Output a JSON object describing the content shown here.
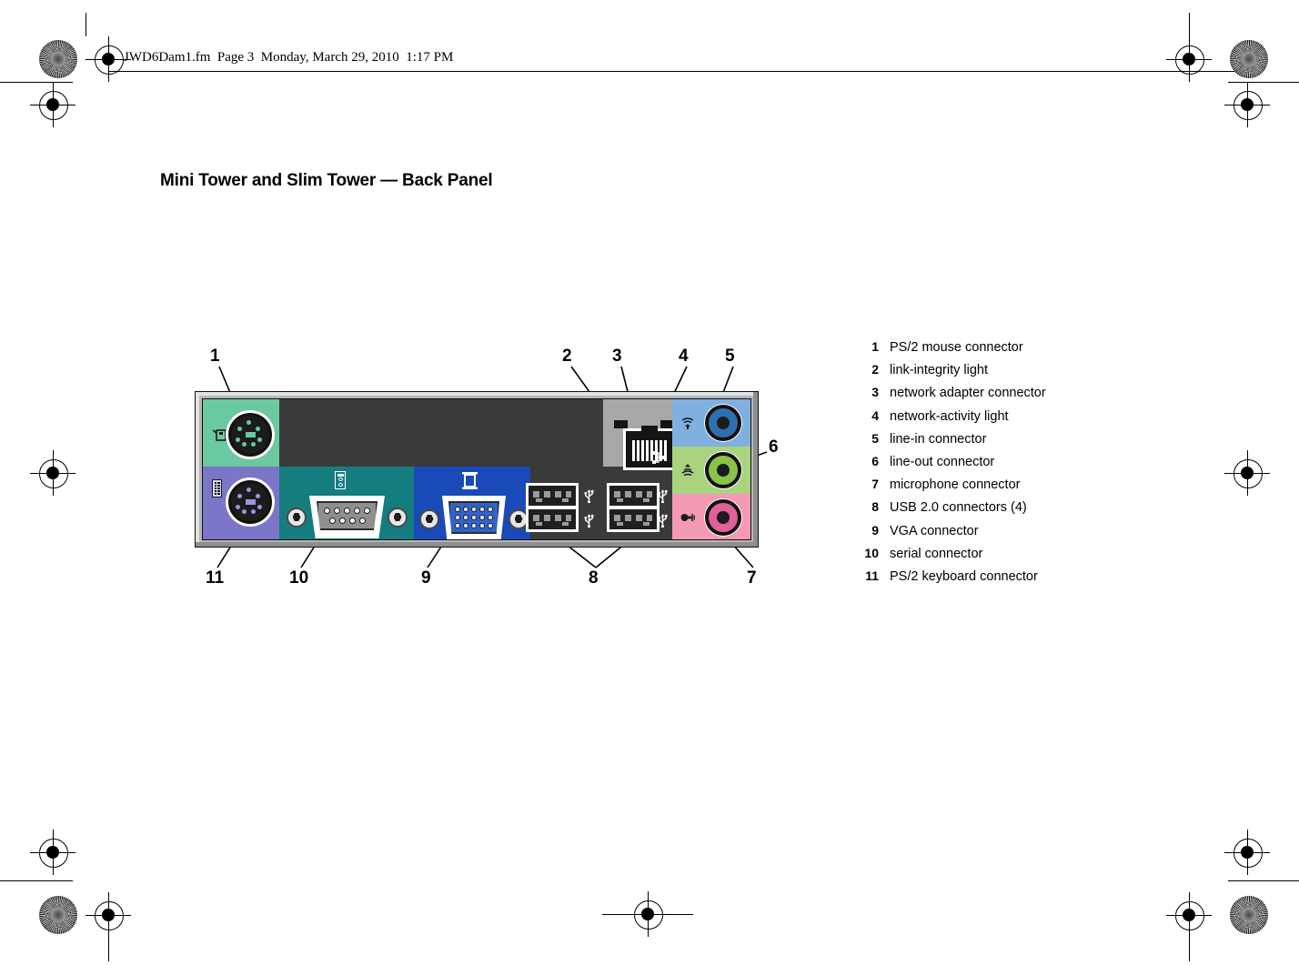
{
  "document": {
    "slug": "JWD6Dam1.fm  Page 3  Monday, March 29, 2010  1:17 PM",
    "title": "Mini Tower and Slim Tower — Back Panel"
  },
  "legend": {
    "items": [
      {
        "num": "1",
        "label": "PS/2 mouse connector"
      },
      {
        "num": "2",
        "label": "link-integrity light"
      },
      {
        "num": "3",
        "label": "network adapter connector"
      },
      {
        "num": "4",
        "label": "network-activity light"
      },
      {
        "num": "5",
        "label": "line-in connector"
      },
      {
        "num": "6",
        "label": "line-out connector"
      },
      {
        "num": "7",
        "label": "microphone connector"
      },
      {
        "num": "8",
        "label": "USB 2.0 connectors (4)"
      },
      {
        "num": "9",
        "label": "VGA connector"
      },
      {
        "num": "10",
        "label": "serial connector"
      },
      {
        "num": "11",
        "label": "PS/2 keyboard connector"
      }
    ]
  },
  "callouts": {
    "c1": "1",
    "c2": "2",
    "c3": "3",
    "c4": "4",
    "c5": "5",
    "c6": "6",
    "c7": "7",
    "c8": "8",
    "c9": "9",
    "c10": "10",
    "c11": "11"
  },
  "panel": {
    "ports": {
      "ps2_mouse": "PS/2 mouse connector",
      "ps2_keyboard": "PS/2 keyboard connector",
      "serial": "serial connector",
      "vga": "VGA connector",
      "network": "network adapter connector",
      "link_integrity_light": "link-integrity light",
      "network_activity_light": "network-activity light",
      "usb_left_pair": "USB 2.0 connectors",
      "usb_right_pair": "USB 2.0 connectors",
      "line_in": "line-in connector",
      "line_out": "line-out connector",
      "microphone": "microphone connector"
    },
    "colors": {
      "ps2_mouse": "#6ac9a0",
      "ps2_keyboard": "#7b76c8",
      "serial": "#167d7f",
      "vga": "#1a49b8",
      "network_plate": "#a8a8a8",
      "line_in": "#7fb0e0",
      "line_out": "#a9d37f",
      "microphone": "#f49ab4",
      "bezel": "#b7b7b7",
      "panel_face": "#3a3a3a"
    }
  }
}
